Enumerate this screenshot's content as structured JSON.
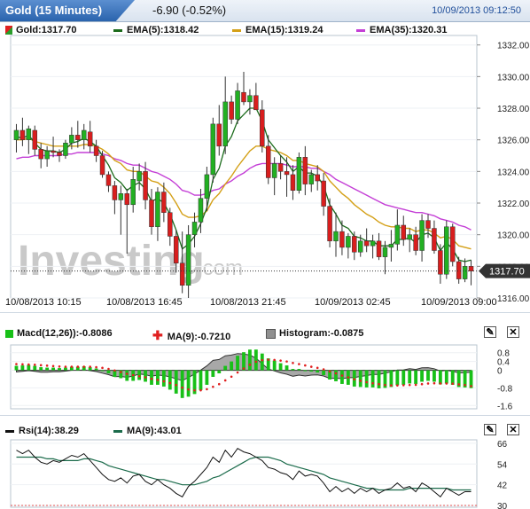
{
  "header": {
    "title": "Gold (15 Minutes)",
    "change": "-6.90 (-0.52%)",
    "datetime": "10/09/2013 09:12:50"
  },
  "legend_main": [
    {
      "label": "Gold:1317.70",
      "color": "#2a9d2a",
      "kind": "candle"
    },
    {
      "label": "EMA(5):1318.42",
      "color": "#1b6b1b",
      "kind": "line"
    },
    {
      "label": "EMA(15):1319.24",
      "color": "#d4a017",
      "kind": "line"
    },
    {
      "label": "EMA(35):1320.31",
      "color": "#c43fd6",
      "kind": "line"
    }
  ],
  "legend_macd": [
    {
      "label": "Macd(12,26)):-0.8086",
      "color": "#18c018"
    },
    {
      "label": "MA(9):-0.7210",
      "color": "#e02020"
    },
    {
      "label": "Histogram:-0.0875",
      "color": "#909090"
    }
  ],
  "legend_rsi": [
    {
      "label": "Rsi(14):38.29",
      "color": "#111111"
    },
    {
      "label": "MA(9):43.01",
      "color": "#1b6b4b"
    }
  ],
  "watermark": {
    "brand": "Investing",
    "suffix": ".com"
  },
  "price_tag": "1317.70",
  "x_labels": [
    "10/08/2013 10:15",
    "10/08/2013 16:45",
    "10/08/2013 21:45",
    "10/09/2013 02:45",
    "10/09/2013 09:00"
  ],
  "chart_data": [
    {
      "type": "candlestick",
      "title": "Gold (15 Minutes)",
      "y_ticks": [
        "1332.00",
        "1330.00",
        "1328.00",
        "1326.00",
        "1324.00",
        "1322.00",
        "1320.00",
        "1318.00",
        "1316.00"
      ],
      "ylim": [
        1316,
        1332.6
      ],
      "last_price": 1317.7,
      "candles": [
        {
          "o": 1326.0,
          "h": 1327.0,
          "l": 1325.2,
          "c": 1326.6
        },
        {
          "o": 1326.6,
          "h": 1327.4,
          "l": 1325.6,
          "c": 1326.0
        },
        {
          "o": 1326.0,
          "h": 1326.9,
          "l": 1325.1,
          "c": 1326.7
        },
        {
          "o": 1326.6,
          "h": 1326.9,
          "l": 1325.0,
          "c": 1325.4
        },
        {
          "o": 1325.4,
          "h": 1325.8,
          "l": 1324.2,
          "c": 1324.8
        },
        {
          "o": 1324.8,
          "h": 1325.6,
          "l": 1324.3,
          "c": 1325.3
        },
        {
          "o": 1325.3,
          "h": 1326.2,
          "l": 1324.9,
          "c": 1325.2
        },
        {
          "o": 1325.2,
          "h": 1325.4,
          "l": 1324.6,
          "c": 1325.0
        },
        {
          "o": 1325.0,
          "h": 1326.0,
          "l": 1324.8,
          "c": 1325.8
        },
        {
          "o": 1325.8,
          "h": 1326.8,
          "l": 1325.4,
          "c": 1326.3
        },
        {
          "o": 1326.3,
          "h": 1327.2,
          "l": 1325.5,
          "c": 1326.0
        },
        {
          "o": 1326.0,
          "h": 1327.0,
          "l": 1325.4,
          "c": 1326.6
        },
        {
          "o": 1326.5,
          "h": 1327.2,
          "l": 1325.2,
          "c": 1325.6
        },
        {
          "o": 1325.6,
          "h": 1326.0,
          "l": 1324.6,
          "c": 1325.0
        },
        {
          "o": 1325.0,
          "h": 1325.3,
          "l": 1323.6,
          "c": 1323.8
        },
        {
          "o": 1323.8,
          "h": 1324.0,
          "l": 1322.7,
          "c": 1323.1
        },
        {
          "o": 1323.1,
          "h": 1323.4,
          "l": 1321.3,
          "c": 1322.2
        },
        {
          "o": 1322.2,
          "h": 1323.1,
          "l": 1320.0,
          "c": 1322.6
        },
        {
          "o": 1322.6,
          "h": 1322.9,
          "l": 1318.8,
          "c": 1321.9
        },
        {
          "o": 1321.9,
          "h": 1324.3,
          "l": 1321.4,
          "c": 1323.5
        },
        {
          "o": 1323.4,
          "h": 1324.5,
          "l": 1322.8,
          "c": 1324.0
        },
        {
          "o": 1324.0,
          "h": 1324.6,
          "l": 1321.6,
          "c": 1322.2
        },
        {
          "o": 1322.2,
          "h": 1322.9,
          "l": 1320.0,
          "c": 1320.5
        },
        {
          "o": 1320.5,
          "h": 1323.0,
          "l": 1319.6,
          "c": 1322.7
        },
        {
          "o": 1322.7,
          "h": 1323.3,
          "l": 1320.8,
          "c": 1321.4
        },
        {
          "o": 1321.4,
          "h": 1321.7,
          "l": 1319.3,
          "c": 1319.9
        },
        {
          "o": 1319.9,
          "h": 1320.3,
          "l": 1317.6,
          "c": 1318.2
        },
        {
          "o": 1318.2,
          "h": 1320.2,
          "l": 1316.3,
          "c": 1316.8
        },
        {
          "o": 1316.8,
          "h": 1320.6,
          "l": 1316.0,
          "c": 1320.0
        },
        {
          "o": 1320.0,
          "h": 1321.4,
          "l": 1319.2,
          "c": 1320.8
        },
        {
          "o": 1320.8,
          "h": 1322.9,
          "l": 1320.1,
          "c": 1322.3
        },
        {
          "o": 1322.3,
          "h": 1324.3,
          "l": 1321.5,
          "c": 1323.8
        },
        {
          "o": 1323.8,
          "h": 1327.4,
          "l": 1323.3,
          "c": 1327.0
        },
        {
          "o": 1327.0,
          "h": 1328.2,
          "l": 1325.0,
          "c": 1325.6
        },
        {
          "o": 1325.6,
          "h": 1330.0,
          "l": 1325.1,
          "c": 1328.4
        },
        {
          "o": 1328.4,
          "h": 1328.8,
          "l": 1327.0,
          "c": 1327.3
        },
        {
          "o": 1327.3,
          "h": 1329.6,
          "l": 1327.0,
          "c": 1329.1
        },
        {
          "o": 1329.0,
          "h": 1330.3,
          "l": 1328.2,
          "c": 1328.4
        },
        {
          "o": 1328.4,
          "h": 1329.2,
          "l": 1327.6,
          "c": 1328.8
        },
        {
          "o": 1328.8,
          "h": 1329.6,
          "l": 1327.9,
          "c": 1327.9
        },
        {
          "o": 1327.9,
          "h": 1328.5,
          "l": 1325.2,
          "c": 1325.6
        },
        {
          "o": 1325.6,
          "h": 1326.3,
          "l": 1323.2,
          "c": 1323.6
        },
        {
          "o": 1323.6,
          "h": 1324.9,
          "l": 1322.5,
          "c": 1324.5
        },
        {
          "o": 1324.5,
          "h": 1325.0,
          "l": 1323.5,
          "c": 1324.0
        },
        {
          "o": 1324.0,
          "h": 1324.9,
          "l": 1322.4,
          "c": 1323.8
        },
        {
          "o": 1323.8,
          "h": 1324.4,
          "l": 1322.2,
          "c": 1322.8
        },
        {
          "o": 1322.8,
          "h": 1325.2,
          "l": 1322.6,
          "c": 1324.9
        },
        {
          "o": 1324.9,
          "h": 1325.6,
          "l": 1322.5,
          "c": 1323.2
        },
        {
          "o": 1323.2,
          "h": 1324.1,
          "l": 1322.7,
          "c": 1323.8
        },
        {
          "o": 1323.8,
          "h": 1324.4,
          "l": 1322.8,
          "c": 1323.4
        },
        {
          "o": 1323.4,
          "h": 1323.9,
          "l": 1321.2,
          "c": 1321.8
        },
        {
          "o": 1321.8,
          "h": 1322.3,
          "l": 1319.2,
          "c": 1319.6
        },
        {
          "o": 1319.6,
          "h": 1321.4,
          "l": 1318.6,
          "c": 1320.2
        },
        {
          "o": 1320.2,
          "h": 1320.9,
          "l": 1318.7,
          "c": 1319.2
        },
        {
          "o": 1319.2,
          "h": 1320.1,
          "l": 1318.5,
          "c": 1319.9
        },
        {
          "o": 1319.9,
          "h": 1320.2,
          "l": 1318.4,
          "c": 1318.9
        },
        {
          "o": 1318.9,
          "h": 1320.0,
          "l": 1318.6,
          "c": 1319.6
        },
        {
          "o": 1319.6,
          "h": 1320.4,
          "l": 1318.9,
          "c": 1319.3
        },
        {
          "o": 1319.3,
          "h": 1320.0,
          "l": 1318.5,
          "c": 1319.6
        },
        {
          "o": 1319.6,
          "h": 1320.1,
          "l": 1318.4,
          "c": 1318.6
        },
        {
          "o": 1318.6,
          "h": 1319.6,
          "l": 1317.5,
          "c": 1319.2
        },
        {
          "o": 1319.2,
          "h": 1320.3,
          "l": 1318.3,
          "c": 1319.4
        },
        {
          "o": 1319.4,
          "h": 1321.6,
          "l": 1319.0,
          "c": 1320.6
        },
        {
          "o": 1320.6,
          "h": 1321.2,
          "l": 1319.3,
          "c": 1319.7
        },
        {
          "o": 1319.7,
          "h": 1320.4,
          "l": 1318.9,
          "c": 1320.0
        },
        {
          "o": 1320.0,
          "h": 1320.5,
          "l": 1318.7,
          "c": 1319.0
        },
        {
          "o": 1319.0,
          "h": 1321.3,
          "l": 1318.3,
          "c": 1320.9
        },
        {
          "o": 1320.9,
          "h": 1321.3,
          "l": 1319.8,
          "c": 1320.4
        },
        {
          "o": 1320.4,
          "h": 1320.9,
          "l": 1318.8,
          "c": 1319.0
        },
        {
          "o": 1319.0,
          "h": 1319.4,
          "l": 1316.9,
          "c": 1317.5
        },
        {
          "o": 1317.5,
          "h": 1320.9,
          "l": 1317.2,
          "c": 1320.5
        },
        {
          "o": 1320.5,
          "h": 1320.7,
          "l": 1318.0,
          "c": 1318.3
        },
        {
          "o": 1318.3,
          "h": 1318.6,
          "l": 1316.9,
          "c": 1317.2
        },
        {
          "o": 1317.2,
          "h": 1318.5,
          "l": 1317.0,
          "c": 1318.0
        },
        {
          "o": 1318.0,
          "h": 1318.4,
          "l": 1316.8,
          "c": 1317.7
        }
      ],
      "ema5": [
        1326.2,
        1326.1,
        1326.3,
        1325.8,
        1325.4,
        1325.3,
        1325.3,
        1325.2,
        1325.4,
        1325.8,
        1325.9,
        1326.1,
        1325.9,
        1325.6,
        1325.0,
        1324.4,
        1323.6,
        1323.3,
        1322.8,
        1323.1,
        1323.3,
        1322.9,
        1322.1,
        1322.3,
        1322.0,
        1321.3,
        1320.3,
        1319.1,
        1319.4,
        1319.9,
        1320.7,
        1321.7,
        1323.5,
        1324.2,
        1325.6,
        1326.2,
        1327.2,
        1327.6,
        1328.0,
        1328.0,
        1327.2,
        1326.0,
        1325.5,
        1325.0,
        1324.6,
        1324.0,
        1324.3,
        1323.9,
        1323.9,
        1323.7,
        1323.1,
        1321.9,
        1321.3,
        1320.6,
        1320.4,
        1319.9,
        1319.8,
        1319.6,
        1319.6,
        1319.3,
        1319.3,
        1319.3,
        1319.7,
        1319.7,
        1319.8,
        1319.5,
        1320.0,
        1320.1,
        1319.8,
        1319.0,
        1319.5,
        1319.1,
        1318.4,
        1318.3,
        1318.4
      ],
      "ema15": [
        1326.0,
        1326.0,
        1326.1,
        1325.9,
        1325.8,
        1325.7,
        1325.6,
        1325.6,
        1325.6,
        1325.6,
        1325.6,
        1325.7,
        1325.7,
        1325.6,
        1325.4,
        1325.1,
        1324.7,
        1324.5,
        1324.1,
        1324.0,
        1324.0,
        1323.7,
        1323.4,
        1323.3,
        1323.0,
        1322.6,
        1322.0,
        1321.3,
        1321.1,
        1321.1,
        1321.2,
        1321.5,
        1322.2,
        1322.6,
        1323.2,
        1323.7,
        1324.3,
        1324.8,
        1325.3,
        1325.6,
        1325.6,
        1325.4,
        1325.3,
        1325.2,
        1325.0,
        1324.7,
        1324.7,
        1324.5,
        1324.4,
        1324.3,
        1324.0,
        1323.4,
        1323.0,
        1322.6,
        1322.3,
        1321.9,
        1321.6,
        1321.3,
        1321.1,
        1320.8,
        1320.6,
        1320.5,
        1320.5,
        1320.4,
        1320.4,
        1320.2,
        1320.3,
        1320.3,
        1320.1,
        1319.8,
        1319.9,
        1319.7,
        1319.3,
        1319.2,
        1319.1
      ],
      "ema35": [
        1324.8,
        1324.9,
        1324.9,
        1325.0,
        1325.0,
        1325.0,
        1325.0,
        1325.0,
        1325.1,
        1325.1,
        1325.2,
        1325.2,
        1325.2,
        1325.2,
        1325.1,
        1325.0,
        1324.8,
        1324.7,
        1324.5,
        1324.4,
        1324.4,
        1324.2,
        1324.0,
        1323.9,
        1323.7,
        1323.5,
        1323.2,
        1322.8,
        1322.7,
        1322.5,
        1322.5,
        1322.6,
        1322.8,
        1322.9,
        1323.2,
        1323.4,
        1323.7,
        1323.9,
        1324.2,
        1324.4,
        1324.5,
        1324.5,
        1324.5,
        1324.5,
        1324.4,
        1324.3,
        1324.3,
        1324.3,
        1324.2,
        1324.2,
        1324.0,
        1323.8,
        1323.5,
        1323.3,
        1323.1,
        1322.9,
        1322.7,
        1322.5,
        1322.3,
        1322.1,
        1321.9,
        1321.8,
        1321.7,
        1321.6,
        1321.5,
        1321.4,
        1321.4,
        1321.3,
        1321.2,
        1321.0,
        1320.9,
        1320.8,
        1320.6,
        1320.5,
        1320.3
      ]
    },
    {
      "type": "bar",
      "title": "Macd(12,26)",
      "y_ticks": [
        "0.8",
        "0.4",
        "0",
        "-0.8",
        "-1.6"
      ],
      "ylim": [
        -1.75,
        1.15
      ],
      "macd": [
        0.2,
        0.22,
        0.24,
        0.2,
        0.14,
        0.12,
        0.12,
        0.1,
        0.12,
        0.16,
        0.16,
        0.18,
        0.14,
        0.08,
        -0.02,
        -0.14,
        -0.3,
        -0.36,
        -0.48,
        -0.48,
        -0.44,
        -0.52,
        -0.66,
        -0.66,
        -0.74,
        -0.88,
        -1.06,
        -1.26,
        -1.2,
        -1.08,
        -0.9,
        -0.66,
        -0.3,
        -0.14,
        0.2,
        0.4,
        0.66,
        0.82,
        0.94,
        0.94,
        0.76,
        0.54,
        0.44,
        0.32,
        0.22,
        0.06,
        0.06,
        -0.04,
        -0.06,
        -0.1,
        -0.22,
        -0.42,
        -0.5,
        -0.62,
        -0.66,
        -0.74,
        -0.76,
        -0.78,
        -0.78,
        -0.82,
        -0.8,
        -0.76,
        -0.68,
        -0.66,
        -0.6,
        -0.62,
        -0.52,
        -0.48,
        -0.52,
        -0.64,
        -0.6,
        -0.66,
        -0.76,
        -0.78,
        -0.81
      ],
      "signal": [
        0.28,
        0.27,
        0.26,
        0.25,
        0.23,
        0.21,
        0.19,
        0.17,
        0.16,
        0.16,
        0.16,
        0.16,
        0.16,
        0.14,
        0.11,
        0.06,
        -0.01,
        -0.08,
        -0.16,
        -0.22,
        -0.27,
        -0.32,
        -0.39,
        -0.44,
        -0.5,
        -0.58,
        -0.67,
        -0.79,
        -0.87,
        -0.91,
        -0.91,
        -0.86,
        -0.75,
        -0.63,
        -0.46,
        -0.29,
        -0.1,
        0.08,
        0.25,
        0.39,
        0.46,
        0.48,
        0.47,
        0.44,
        0.4,
        0.33,
        0.28,
        0.22,
        0.16,
        0.11,
        0.04,
        -0.05,
        -0.14,
        -0.24,
        -0.32,
        -0.41,
        -0.48,
        -0.54,
        -0.59,
        -0.63,
        -0.67,
        -0.69,
        -0.69,
        -0.68,
        -0.67,
        -0.66,
        -0.63,
        -0.6,
        -0.59,
        -0.6,
        -0.6,
        -0.61,
        -0.64,
        -0.67,
        -0.72
      ]
    },
    {
      "type": "line",
      "title": "Rsi(14)",
      "y_ticks": [
        "66",
        "54",
        "42",
        "30"
      ],
      "ylim": [
        29,
        68
      ],
      "rsi": [
        62,
        60,
        62,
        58,
        55,
        54,
        56,
        55,
        57,
        59,
        58,
        60,
        56,
        52,
        48,
        45,
        44,
        46,
        43,
        47,
        48,
        44,
        42,
        45,
        42,
        40,
        37,
        35,
        41,
        44,
        48,
        52,
        58,
        55,
        62,
        58,
        63,
        61,
        60,
        58,
        56,
        52,
        51,
        49,
        48,
        45,
        50,
        47,
        48,
        47,
        43,
        38,
        41,
        38,
        40,
        37,
        40,
        38,
        40,
        37,
        39,
        40,
        43,
        40,
        41,
        38,
        43,
        41,
        38,
        35,
        40,
        38,
        36,
        38,
        38
      ],
      "rsi_ma": [
        58,
        58,
        58,
        58,
        58,
        57,
        57,
        56,
        56,
        56,
        56,
        57,
        57,
        56,
        55,
        53,
        52,
        51,
        50,
        49,
        48,
        47,
        46,
        45,
        45,
        44,
        43,
        42,
        42,
        42,
        43,
        44,
        46,
        47,
        49,
        51,
        53,
        55,
        57,
        58,
        58,
        58,
        57,
        56,
        54,
        53,
        52,
        51,
        50,
        49,
        48,
        46,
        45,
        44,
        43,
        42,
        41,
        40,
        40,
        39,
        39,
        39,
        39,
        39,
        40,
        40,
        40,
        40,
        40,
        40,
        40,
        39,
        39,
        39,
        39
      ]
    }
  ]
}
